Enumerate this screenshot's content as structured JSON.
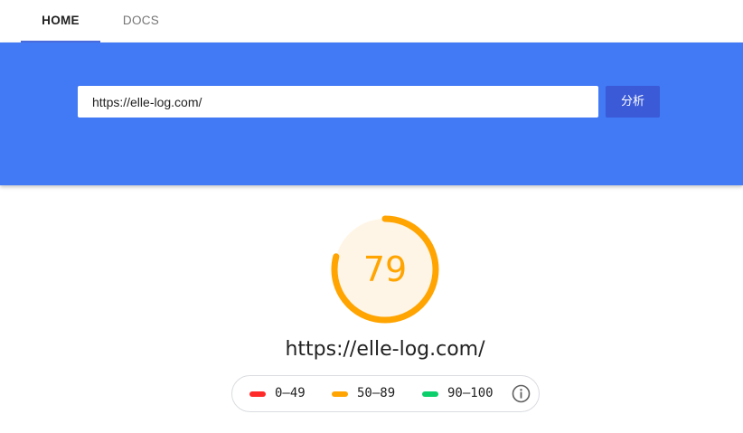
{
  "nav": {
    "tabs": [
      {
        "label": "HOME",
        "active": true
      },
      {
        "label": "DOCS",
        "active": false
      }
    ]
  },
  "search": {
    "value": "https://elle-log.com/",
    "button_label": "分析"
  },
  "result": {
    "score": "79",
    "score_fraction": 0.79,
    "url": "https://elle-log.com/"
  },
  "legend": {
    "items": [
      {
        "label": "0–49",
        "color": "#ff2a2a"
      },
      {
        "label": "50–89",
        "color": "#ffa400"
      },
      {
        "label": "90–100",
        "color": "#0cce6b"
      }
    ],
    "info_icon": "info-icon"
  },
  "colors": {
    "hero_background": "#4279f4",
    "button": "#3a5ad8",
    "gauge_ring": "#ffa400",
    "gauge_fill": "#fff5e6",
    "tab_indicator": "#4a6ee0"
  }
}
